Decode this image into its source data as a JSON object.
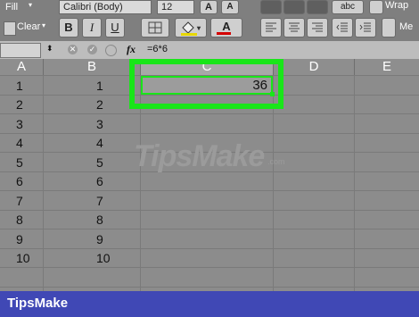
{
  "ribbon": {
    "fill_label": "Fill",
    "clear_label": "Clear",
    "font_name": "Calibri (Body)",
    "font_size": "12",
    "bold": "B",
    "italic": "I",
    "underline": "U",
    "grow_font": "A",
    "shrink_font": "A",
    "font_color": "A",
    "abc_label": "abc",
    "wrap_label": "Wrap",
    "merge_label": "Me"
  },
  "formula_bar": {
    "fx": "fx",
    "formula": "=6*6"
  },
  "columns": [
    "A",
    "B",
    "C",
    "D",
    "E"
  ],
  "col_a": [
    "1",
    "2",
    "3",
    "4",
    "5",
    "6",
    "7",
    "8",
    "9",
    "10"
  ],
  "col_b": [
    "1",
    "2",
    "3",
    "4",
    "5",
    "6",
    "7",
    "8",
    "9",
    "10"
  ],
  "selected_cell_value": "36",
  "watermark": "TipsMake",
  "footer_brand": "TipsMake",
  "colors": {
    "highlight": "#19e619",
    "footer": "#4048b5"
  }
}
